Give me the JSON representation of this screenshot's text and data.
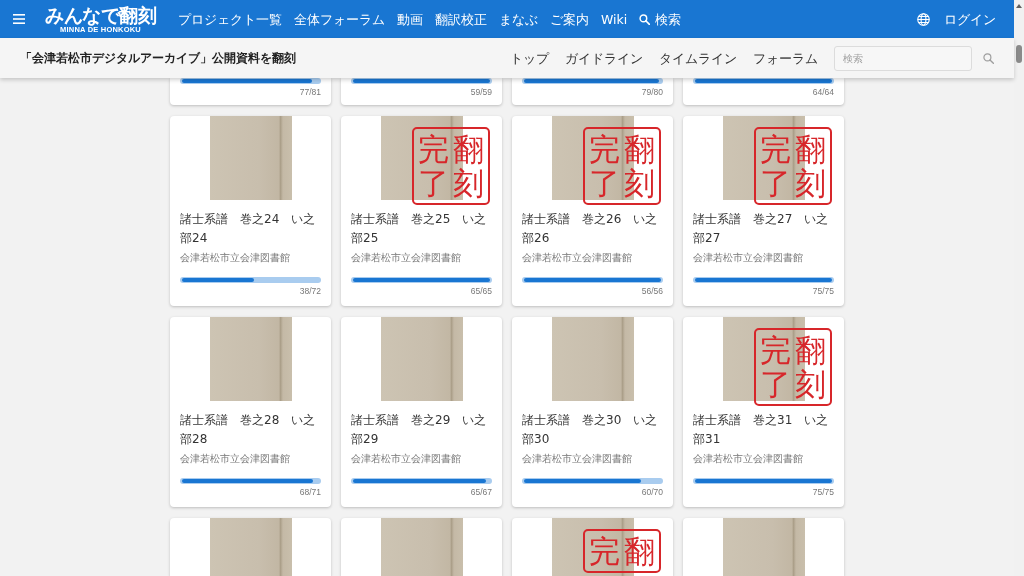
{
  "header": {
    "logo": "みんなで翻刻",
    "logo_caption": "MINNA DE HONKOKU",
    "nav": [
      {
        "kind": "link",
        "label": "プロジェクト一覧"
      },
      {
        "kind": "link",
        "label": "全体フォーラム"
      },
      {
        "kind": "link",
        "label": "動画"
      },
      {
        "kind": "link",
        "label": "翻訳校正"
      },
      {
        "kind": "link",
        "label": "まなぶ"
      },
      {
        "kind": "link",
        "label": "ご案内"
      },
      {
        "kind": "link",
        "label": "Wiki"
      },
      {
        "kind": "search",
        "label": "検索"
      }
    ],
    "login": "ログイン"
  },
  "project_bar": {
    "title": "「会津若松市デジタルアーカイブ」公開資料を翻刻",
    "links": [
      {
        "label": "トップ"
      },
      {
        "label": "ガイドライン"
      },
      {
        "label": "タイムライン"
      },
      {
        "label": "フォーラム"
      }
    ],
    "search": {
      "placeholder": "検索"
    }
  },
  "cards": [
    {
      "kind": "lower",
      "level": 0.951,
      "count": "77/81"
    },
    {
      "kind": "lower",
      "level": 1,
      "count": "59/59"
    },
    {
      "kind": "lower",
      "level": 0.988,
      "count": "79/80"
    },
    {
      "kind": "lower",
      "level": 1,
      "count": "64/64"
    },
    {
      "kind": "full",
      "title": "諸士系譜　巻之24　い之部24",
      "library": "会津若松市立会津図書館",
      "level": 0.528,
      "count": "38/72"
    },
    {
      "kind": "full",
      "title": "諸士系譜　巻之25　い之部25",
      "library": "会津若松市立会津図書館",
      "level": 1,
      "count": "65/65",
      "stamp": [
        "完了",
        "翻刻"
      ]
    },
    {
      "kind": "full",
      "title": "諸士系譜　巻之26　い之部26",
      "library": "会津若松市立会津図書館",
      "level": 1,
      "count": "56/56",
      "stamp": [
        "完了",
        "翻刻"
      ]
    },
    {
      "kind": "full",
      "title": "諸士系譜　巻之27　い之部27",
      "library": "会津若松市立会津図書館",
      "level": 1,
      "count": "75/75",
      "stamp": [
        "完了",
        "翻刻"
      ]
    },
    {
      "kind": "full",
      "title": "諸士系譜　巻之28　い之部28",
      "library": "会津若松市立会津図書館",
      "level": 0.958,
      "count": "68/71"
    },
    {
      "kind": "full",
      "title": "諸士系譜　巻之29　い之部29",
      "library": "会津若松市立会津図書館",
      "level": 0.97,
      "count": "65/67"
    },
    {
      "kind": "full",
      "title": "諸士系譜　巻之30　い之部30",
      "library": "会津若松市立会津図書館",
      "level": 0.857,
      "count": "60/70"
    },
    {
      "kind": "full",
      "title": "諸士系譜　巻之31　い之部31",
      "library": "会津若松市立会津図書館",
      "level": 1,
      "count": "75/75",
      "stamp": [
        "完了",
        "翻刻"
      ]
    },
    {
      "kind": "upper"
    },
    {
      "kind": "upper"
    },
    {
      "kind": "upper",
      "stamp": [
        "完",
        "翻"
      ]
    },
    {
      "kind": "upper"
    }
  ]
}
